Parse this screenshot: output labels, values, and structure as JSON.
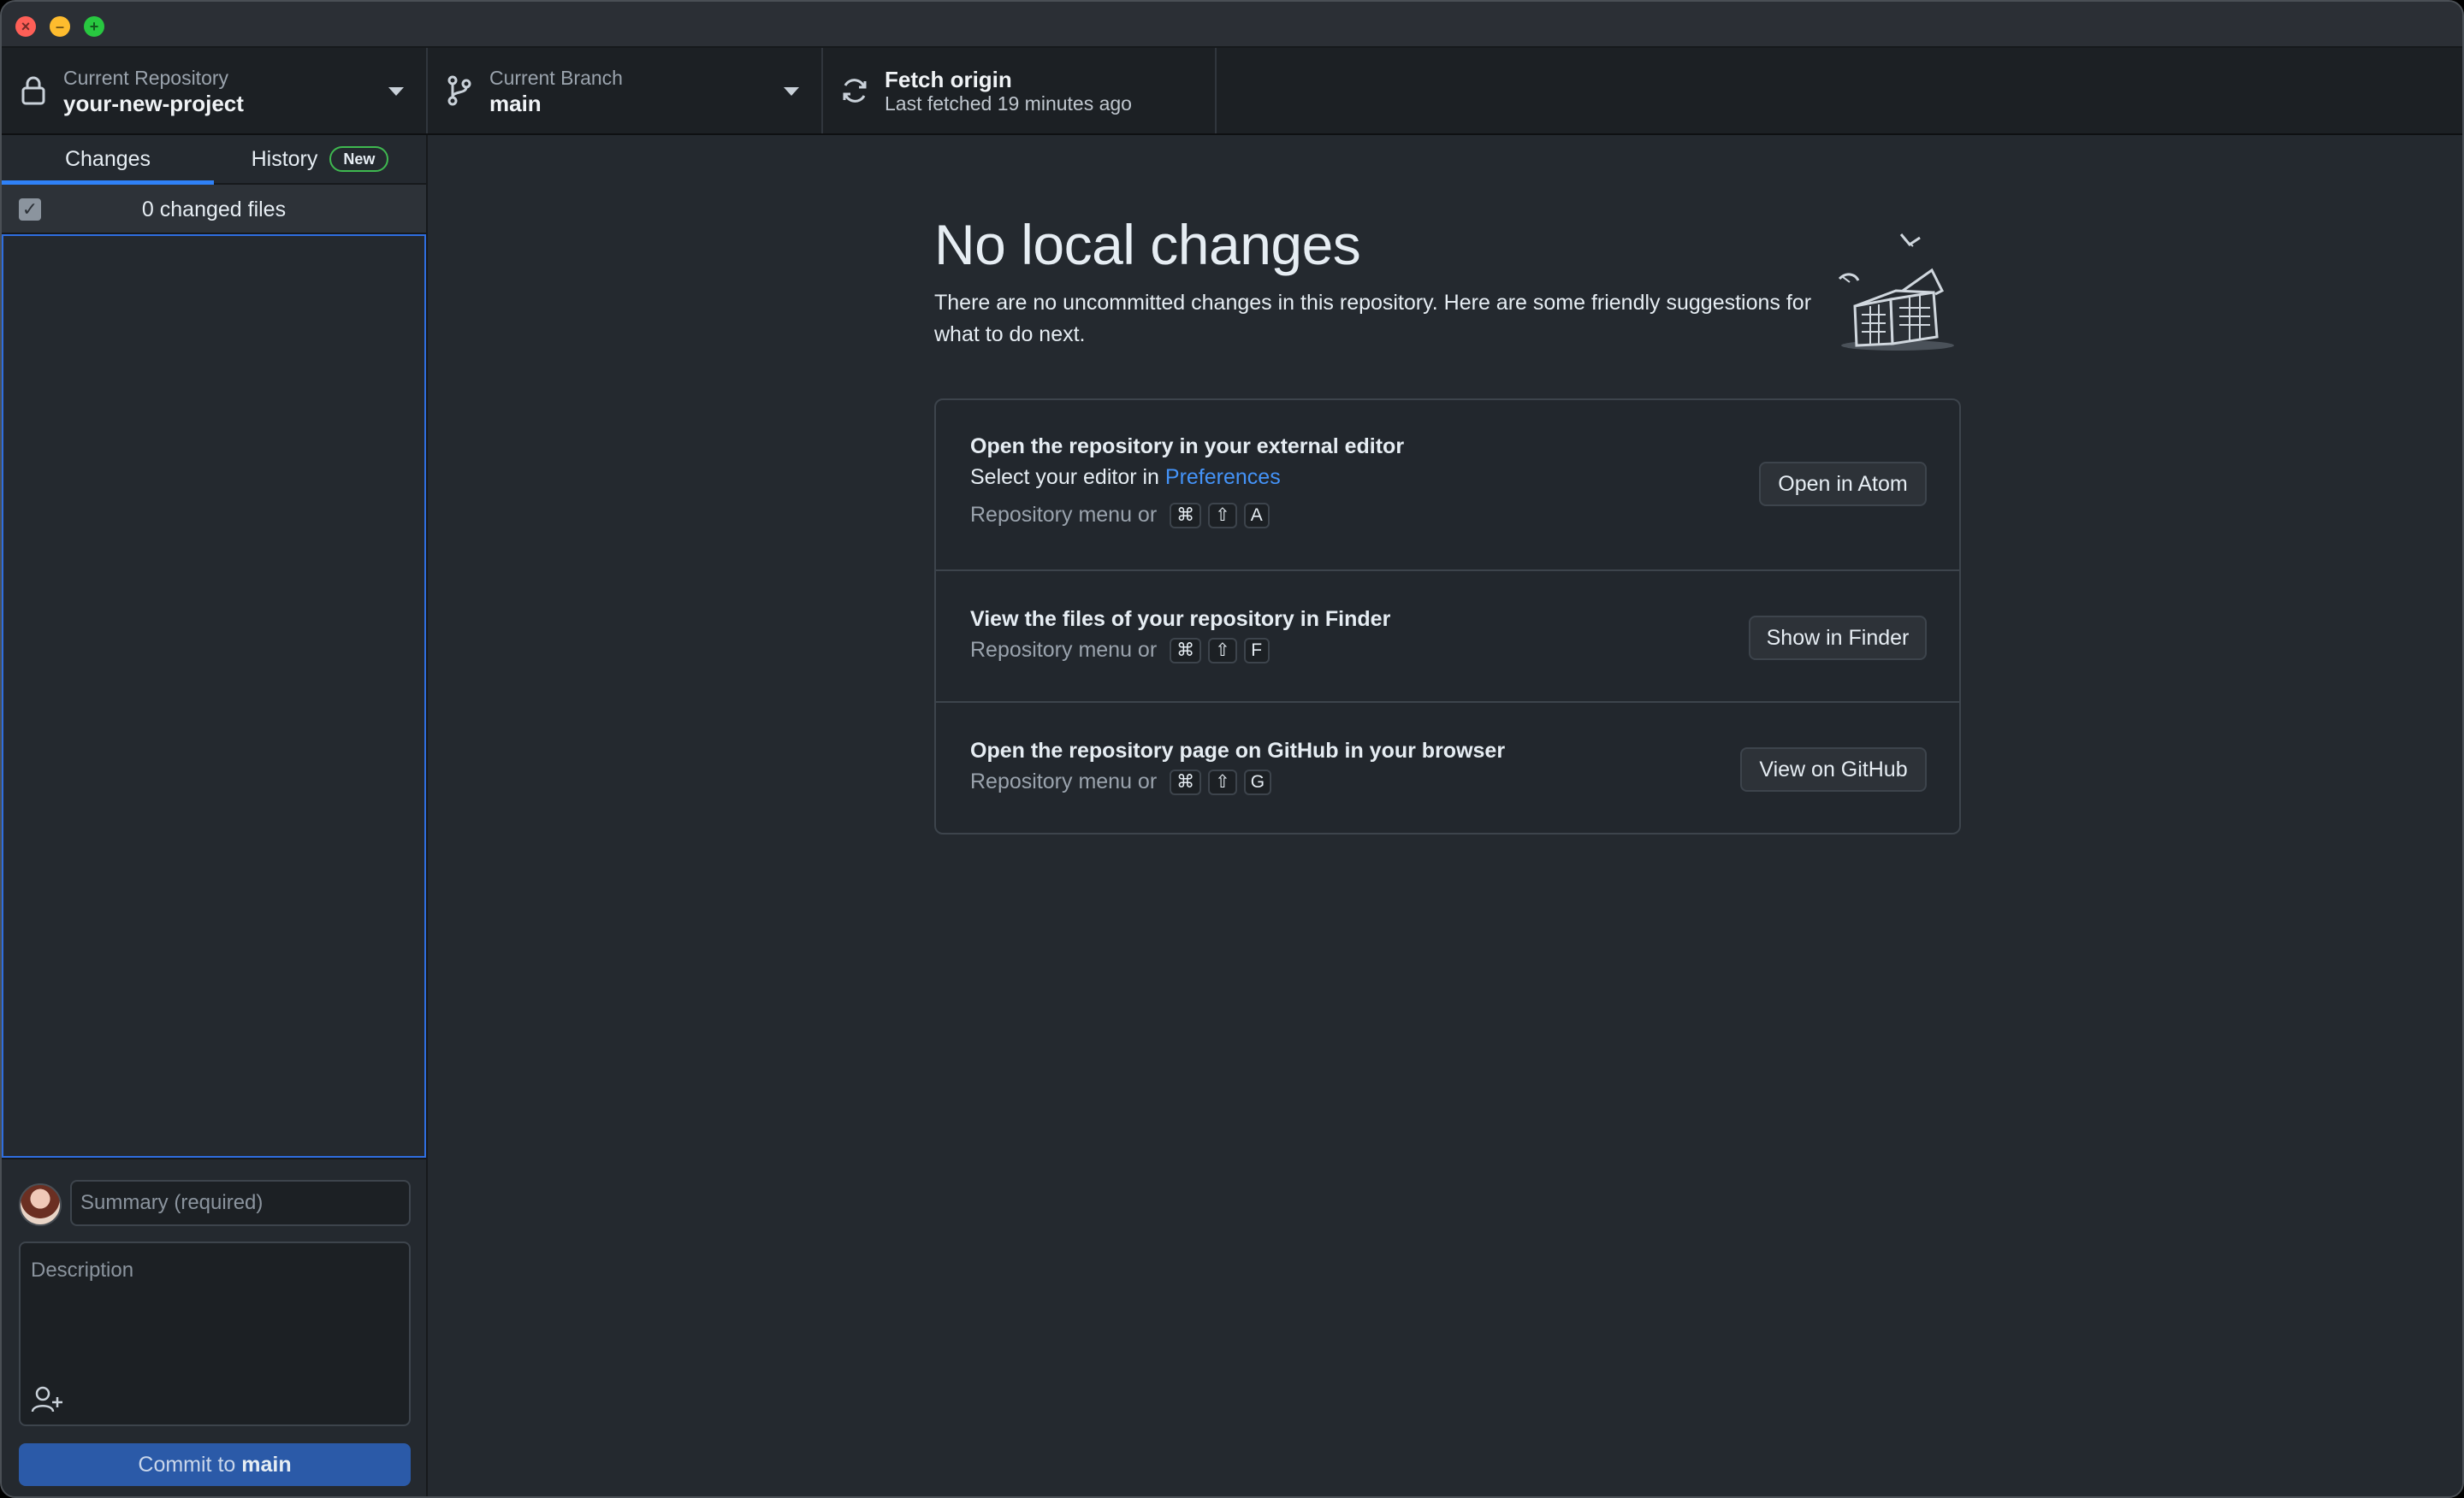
{
  "window": {
    "controls": [
      "close",
      "minimize",
      "maximize"
    ]
  },
  "toolbar": {
    "repository": {
      "label": "Current Repository",
      "value": "your-new-project",
      "icon": "lock-icon"
    },
    "branch": {
      "label": "Current Branch",
      "value": "main",
      "icon": "git-branch-icon"
    },
    "fetch": {
      "label": "Fetch origin",
      "status": "Last fetched 19 minutes ago",
      "icon": "sync-icon"
    }
  },
  "sidebar": {
    "tabs": [
      {
        "label": "Changes",
        "selected": true
      },
      {
        "label": "History",
        "badge": "New",
        "selected": false
      }
    ],
    "files_header": {
      "count_label": "0 changed files",
      "checked": true
    },
    "commit": {
      "summary_placeholder": "Summary (required)",
      "description_placeholder": "Description",
      "button_prefix": "Commit to",
      "button_branch": "main"
    }
  },
  "main": {
    "title": "No local changes",
    "intro": "There are no uncommitted changes in this repository. Here are some friendly suggestions for what to do next.",
    "suggestions": [
      {
        "title": "Open the repository in your external editor",
        "subtitle_prefix": "Select your editor in",
        "subtitle_link": "Preferences",
        "hint": "Repository menu or",
        "keys": [
          "⌘",
          "⇧",
          "A"
        ],
        "button": "Open in Atom"
      },
      {
        "title": "View the files of your repository in Finder",
        "hint": "Repository menu or",
        "keys": [
          "⌘",
          "⇧",
          "F"
        ],
        "button": "Show in Finder"
      },
      {
        "title": "Open the repository page on GitHub in your browser",
        "hint": "Repository menu or",
        "keys": [
          "⌘",
          "⇧",
          "G"
        ],
        "button": "View on GitHub"
      }
    ]
  },
  "colors": {
    "accent": "#2f81f7",
    "link": "#4493f8",
    "badge_border": "#3fb950",
    "commit_button": "#2b5aa8",
    "background": "#24292f",
    "toolbar_background": "#1c2024"
  }
}
